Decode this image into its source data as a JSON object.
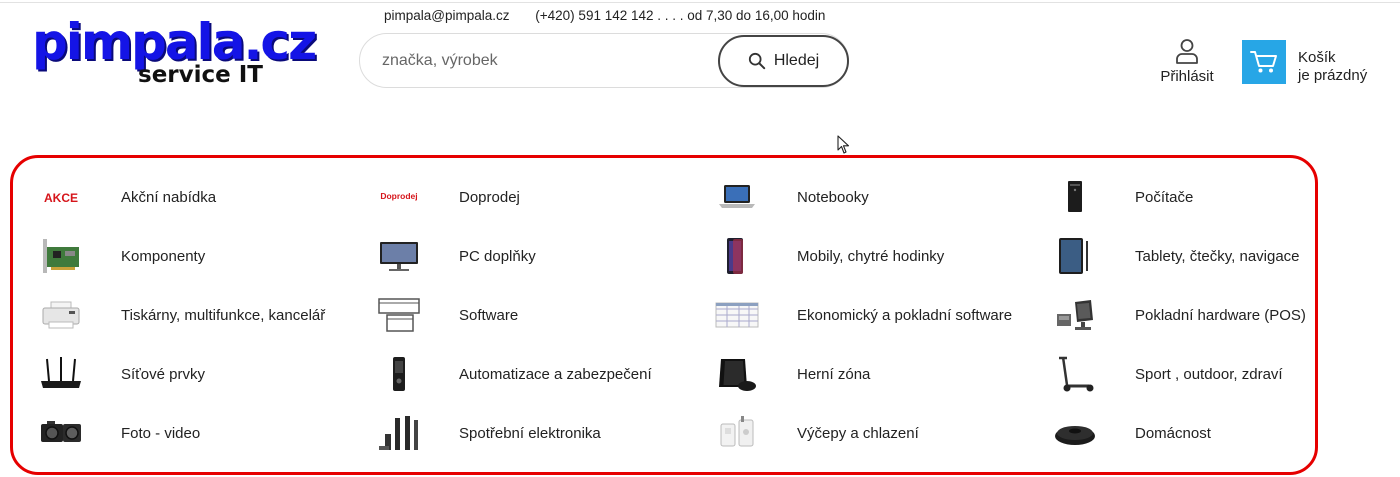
{
  "header": {
    "logo_main": "pimpala.cz",
    "logo_sub": "service IT",
    "email": "pimpala@pimpala.cz",
    "phone_hours": "(+420) 591 142 142 . . . . od 7,30 do 16,00 hodin"
  },
  "search": {
    "placeholder": "značka, výrobek",
    "button_label": "Hledej"
  },
  "user": {
    "login_label": "Přihlásit"
  },
  "cart": {
    "line1": "Košík",
    "line2": "je prázdný"
  },
  "colors": {
    "accent_blue": "#27a6e6",
    "logo_blue": "#1414e6",
    "border_red": "#e60000"
  },
  "categories": [
    {
      "label": "Akční nabídka",
      "icon": "akce-badge-icon"
    },
    {
      "label": "Doprodej",
      "icon": "doprodej-badge-icon"
    },
    {
      "label": "Notebooky",
      "icon": "laptop-icon"
    },
    {
      "label": "Počítače",
      "icon": "pc-tower-icon"
    },
    {
      "label": "Komponenty",
      "icon": "circuit-board-icon"
    },
    {
      "label": "PC doplňky",
      "icon": "monitor-icon"
    },
    {
      "label": "Mobily, chytré hodinky",
      "icon": "smartphone-icon"
    },
    {
      "label": "Tablety, čtečky, navigace",
      "icon": "tablet-icon"
    },
    {
      "label": "Tiskárny, multifunkce, kancelář",
      "icon": "printer-icon"
    },
    {
      "label": "Software",
      "icon": "software-windows-icon"
    },
    {
      "label": "Ekonomický a pokladní software",
      "icon": "spreadsheet-icon"
    },
    {
      "label": "Pokladní hardware (POS)",
      "icon": "pos-terminal-icon"
    },
    {
      "label": "Síťové prvky",
      "icon": "router-icon"
    },
    {
      "label": "Automatizace a zabezpečení",
      "icon": "security-device-icon"
    },
    {
      "label": "Herní zóna",
      "icon": "game-console-icon"
    },
    {
      "label": "Sport , outdoor, zdraví",
      "icon": "scooter-icon"
    },
    {
      "label": "Foto - video",
      "icon": "camera-icon"
    },
    {
      "label": "Spotřební elektronika",
      "icon": "speakers-icon"
    },
    {
      "label": "Výčepy a chlazení",
      "icon": "beer-tap-icon"
    },
    {
      "label": "Domácnost",
      "icon": "robot-vacuum-icon"
    }
  ]
}
